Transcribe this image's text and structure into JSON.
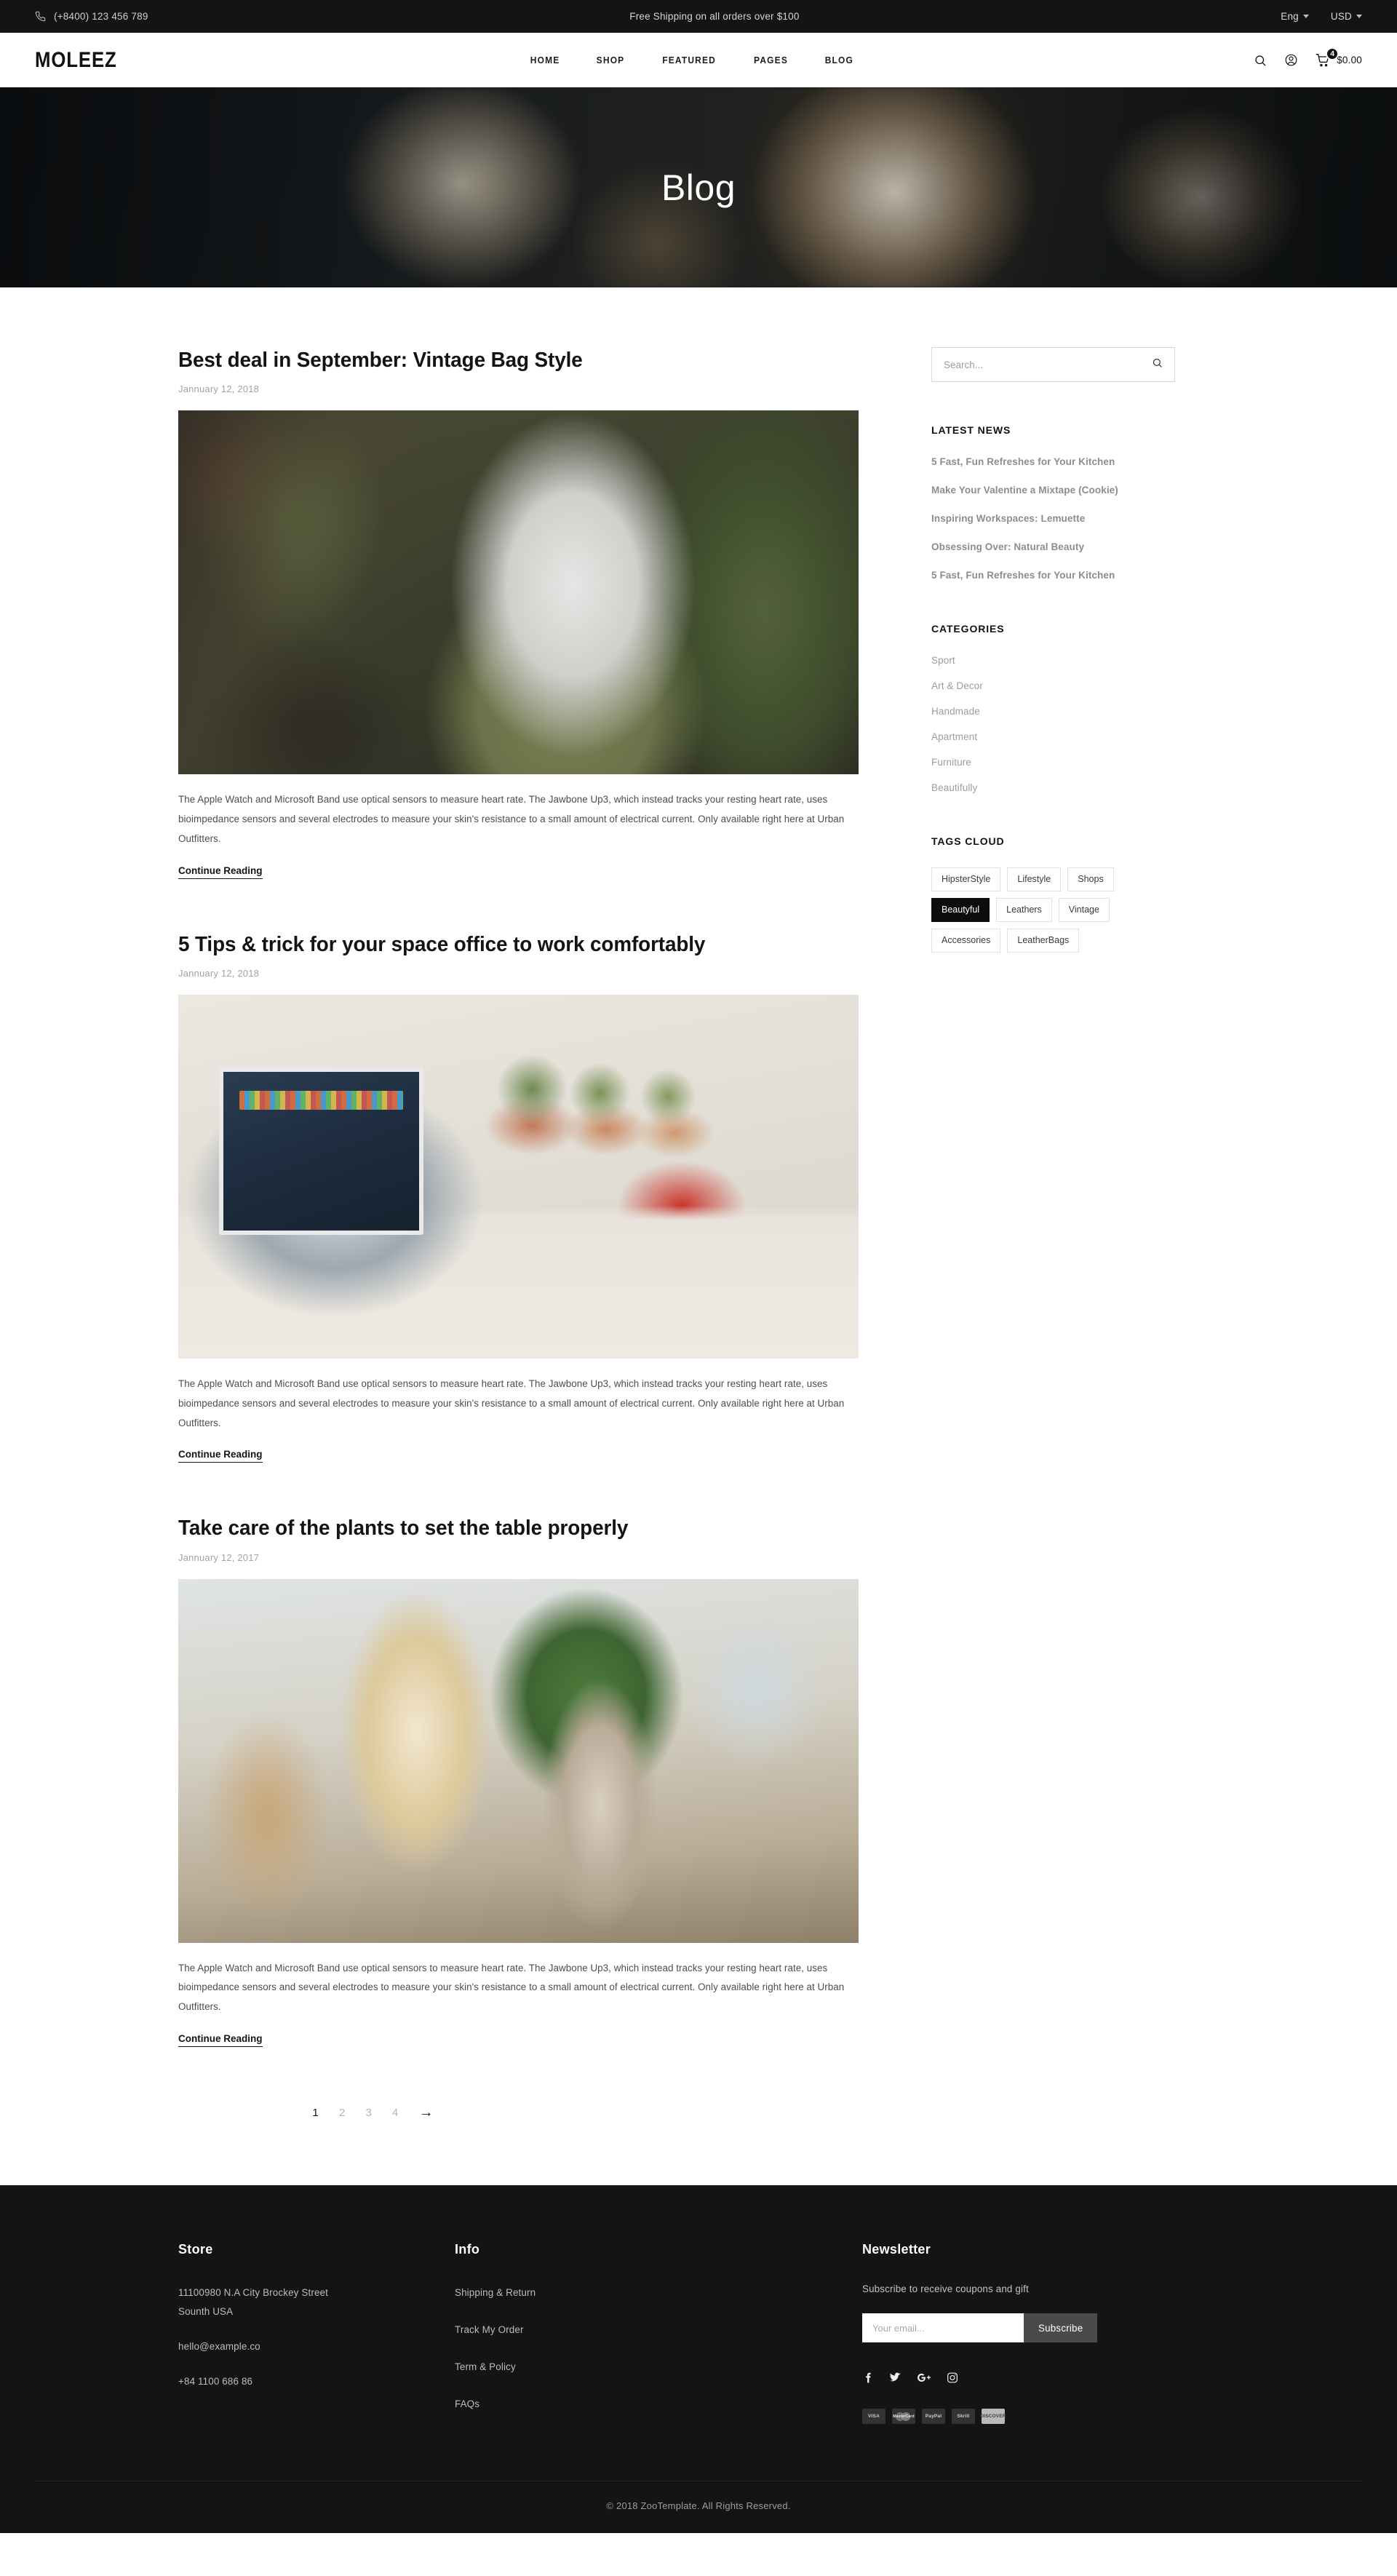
{
  "topbar": {
    "phone_icon": "phone-icon",
    "phone": "(+8400) 123 456 789",
    "promo": "Free Shipping on all orders over $100",
    "language": "Eng",
    "currency": "USD"
  },
  "header": {
    "logo": "MOLEEZ",
    "nav": [
      {
        "label": "HOME"
      },
      {
        "label": "SHOP"
      },
      {
        "label": "FEATURED"
      },
      {
        "label": "PAGES"
      },
      {
        "label": "BLOG"
      }
    ],
    "search_icon": "search-icon",
    "account_icon": "user-icon",
    "cart_icon": "shopping-cart-icon",
    "cart_count": "4",
    "cart_total": "$0.00"
  },
  "hero": {
    "title": "Blog"
  },
  "posts": [
    {
      "title": "Best deal in September: Vintage Bag Style",
      "date": "Jannuary 12, 2018",
      "image_alt": "person-putting-laptop-in-canvas-backpack",
      "excerpt": "The Apple Watch and Microsoft Band use optical sensors to measure heart rate. The Jawbone Up3, which instead tracks your resting heart rate, uses bioimpedance sensors and several electrodes to measure your skin's resistance to a small amount of electrical current. Only available right here at Urban Outfitters.",
      "read_more": "Continue Reading"
    },
    {
      "title": "5 Tips & trick for your space office to work comfortably",
      "date": "Jannuary 12, 2018",
      "image_alt": "laptop-plants-and-magazines-on-white-desk",
      "excerpt": "The Apple Watch and Microsoft Band use optical sensors to measure heart rate. The Jawbone Up3, which instead tracks your resting heart rate, uses bioimpedance sensors and several electrodes to measure your skin's resistance to a small amount of electrical current. Only available right here at Urban Outfitters.",
      "read_more": "Continue Reading"
    },
    {
      "title": "Take care of the plants to set the table properly",
      "date": "Jannuary 12, 2017",
      "image_alt": "pour-over-coffee-brewer-and-kettle-with-plant",
      "excerpt": "The Apple Watch and Microsoft Band use optical sensors to measure heart rate. The Jawbone Up3, which instead tracks your resting heart rate, uses bioimpedance sensors and several electrodes to measure your skin's resistance to a small amount of electrical current. Only available right here at Urban Outfitters.",
      "read_more": "Continue Reading"
    }
  ],
  "pagination": {
    "pages": [
      "1",
      "2",
      "3",
      "4"
    ],
    "active": "1",
    "next_icon": "arrow-right-icon",
    "next_label": "→"
  },
  "sidebar": {
    "search": {
      "placeholder": "Search...",
      "value": "",
      "icon": "search-icon"
    },
    "latest_news": {
      "title": "LATEST NEWS",
      "items": [
        "5 Fast, Fun Refreshes for Your Kitchen",
        "Make Your Valentine a Mixtape (Cookie)",
        "Inspiring Workspaces: Lemuette",
        "Obsessing Over: Natural Beauty",
        "5 Fast, Fun Refreshes for Your Kitchen"
      ]
    },
    "categories": {
      "title": "CATEGORIES",
      "items": [
        "Sport",
        "Art & Decor",
        "Handmade",
        "Apartment",
        "Furniture",
        "Beautifully"
      ]
    },
    "tags_cloud": {
      "title": "TAGS CLOUD",
      "items": [
        {
          "label": "HipsterStyle",
          "active": false
        },
        {
          "label": "Lifestyle",
          "active": false
        },
        {
          "label": "Shops",
          "active": false
        },
        {
          "label": "Beautyful",
          "active": true
        },
        {
          "label": "Leathers",
          "active": false
        },
        {
          "label": "Vintage",
          "active": false
        },
        {
          "label": "Accessories",
          "active": false
        },
        {
          "label": "LeatherBags",
          "active": false
        }
      ]
    }
  },
  "footer": {
    "store": {
      "title": "Store",
      "address_line1": "11100980 N.A City Brockey Street",
      "address_line2": "Sounth USA",
      "email": "hello@example.co",
      "phone": "+84 1100 686 86"
    },
    "info": {
      "title": "Info",
      "links": [
        "Shipping & Return",
        "Track My Order",
        "Term & Policy",
        "FAQs"
      ]
    },
    "newsletter": {
      "title": "Newsletter",
      "subtitle": "Subscribe to receive coupons and gift",
      "placeholder": "Your email...",
      "value": "",
      "button": "Subscribe",
      "socials": [
        {
          "name": "facebook-icon",
          "glyph": "f"
        },
        {
          "name": "twitter-icon",
          "glyph": "🐦"
        },
        {
          "name": "google-plus-icon",
          "glyph": "G+"
        },
        {
          "name": "instagram-icon",
          "glyph": "◉"
        }
      ],
      "payments": [
        {
          "name": "visa-badge",
          "label": "VISA"
        },
        {
          "name": "mastercard-badge",
          "label": "MasterCard"
        },
        {
          "name": "paypal-badge",
          "label": "PayPal"
        },
        {
          "name": "skrill-badge",
          "label": "Skrill"
        },
        {
          "name": "discover-badge",
          "label": "DISCOVER"
        }
      ]
    },
    "copyright": "© 2018 ZooTemplate. All Rights Reserved."
  },
  "colors": {
    "dark": "#141414",
    "accent": "#0d0d0d",
    "muted": "#9c9c9c"
  }
}
